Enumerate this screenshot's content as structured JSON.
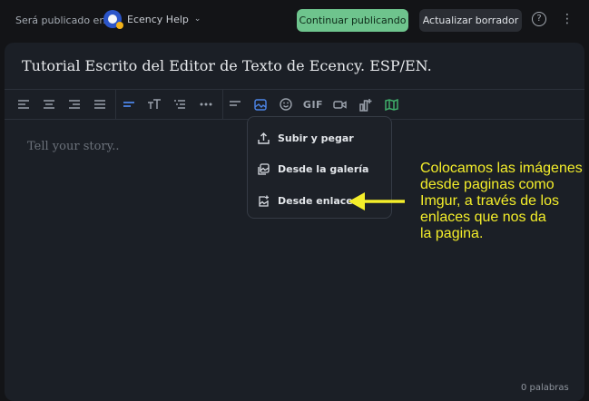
{
  "header": {
    "publish_label": "Será publicado en",
    "community_name": "Ecency Help",
    "publish_button": "Continuar publicando",
    "draft_button": "Actualizar borrador"
  },
  "editor": {
    "title": "Tutorial Escrito del Editor de Texto de Ecency. ESP/EN.",
    "placeholder": "Tell your story..",
    "word_count": "0 palabras"
  },
  "toolbar": {
    "gif_label": "GIF"
  },
  "image_menu": {
    "items": [
      {
        "label": "Subir y pegar",
        "icon": "upload-icon"
      },
      {
        "label": "Desde la galería",
        "icon": "gallery-icon"
      },
      {
        "label": "Desde enlace",
        "icon": "image-link-icon"
      }
    ]
  },
  "annotation": {
    "lines": [
      "Colocamos las imágenes",
      "desde paginas como",
      "Imgur, a través de los",
      "enlaces que nos da",
      "la pagina."
    ],
    "color": "#f4ee2a"
  },
  "colors": {
    "accent_blue": "#4d86e8",
    "publish_green": "#6ec48d",
    "background": "#131417",
    "panel": "#1b1f26"
  }
}
